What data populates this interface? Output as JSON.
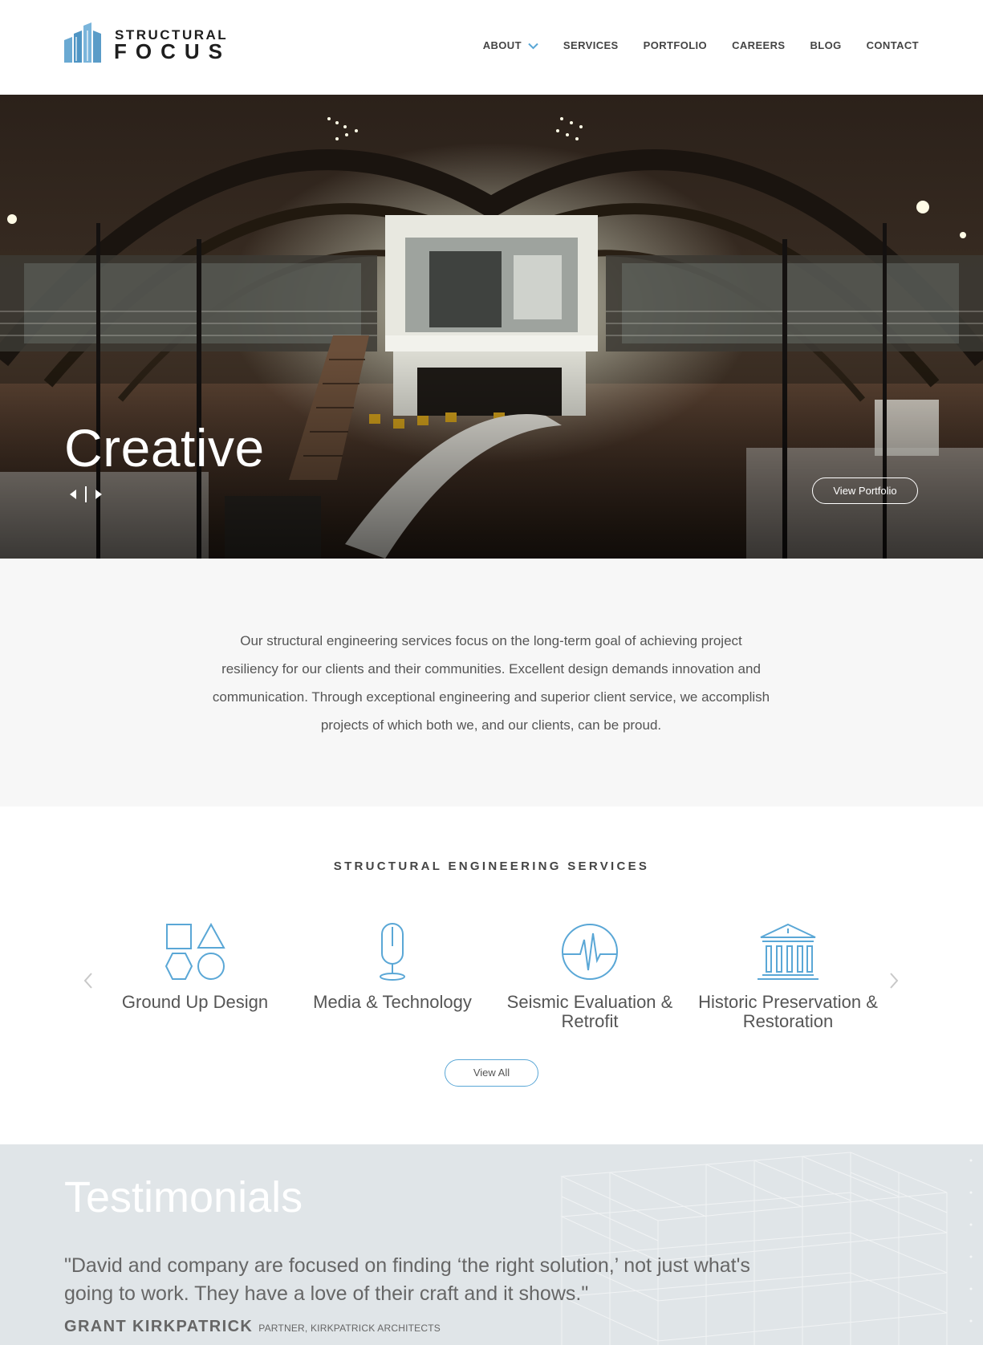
{
  "header": {
    "logo": {
      "line1": "STRUCTURAL",
      "line2": "FOCUS"
    },
    "nav": [
      {
        "label": "ABOUT"
      },
      {
        "label": "SERVICES"
      },
      {
        "label": "PORTFOLIO"
      },
      {
        "label": "CAREERS"
      },
      {
        "label": "BLOG"
      },
      {
        "label": "CONTACT"
      }
    ]
  },
  "hero": {
    "title": "Creative",
    "button_label": "View Portfolio",
    "prev_icon": "caret-left-icon",
    "next_icon": "caret-right-icon"
  },
  "intro": {
    "text": "Our structural engineering services focus on the long-term goal of achieving project resiliency for our clients and their communities. Excellent design demands innovation and communication. Through exceptional engineering and superior client service, we accomplish projects of which both we, and our clients, can be proud."
  },
  "services": {
    "heading": "STRUCTURAL ENGINEERING SERVICES",
    "items": [
      {
        "label": "Ground Up Design",
        "icon": "shapes-icon"
      },
      {
        "label": "Media & Technology",
        "icon": "microphone-icon"
      },
      {
        "label": "Seismic Evaluation & Retrofit",
        "icon": "seismic-pulse-icon"
      },
      {
        "label": "Historic Preservation & Restoration",
        "icon": "historic-building-icon"
      }
    ],
    "button_label": "View All"
  },
  "testimonials": {
    "title": "Testimonials",
    "quote": "\"David and company are focused on finding ‘the right solution,’ not just what's going to work. They have a love of their craft and it shows.\"",
    "author": "GRANT KIRKPATRICK",
    "role": "PARTNER, KIRKPATRICK ARCHITECTS"
  },
  "colors": {
    "accent": "#5aa7d6",
    "text": "#555555",
    "intro_bg": "#f7f7f7",
    "testimonial_bg": "#e0e5e8"
  }
}
